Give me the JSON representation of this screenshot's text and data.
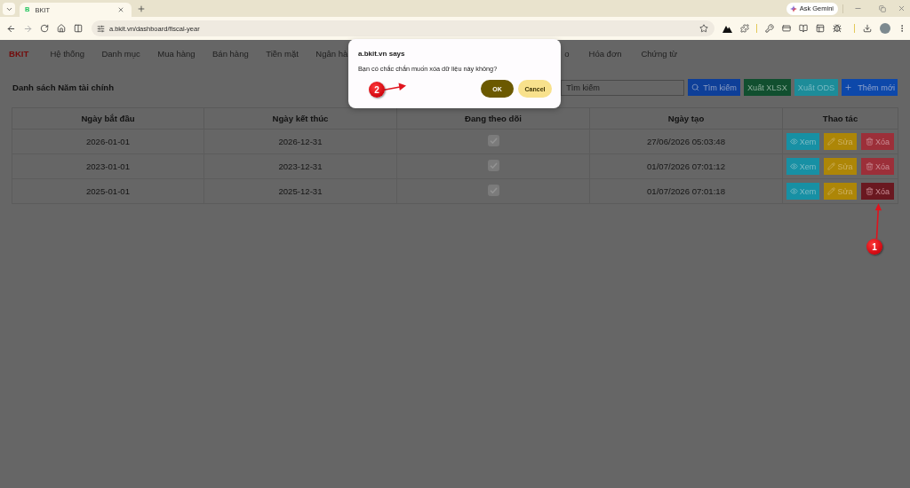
{
  "browser": {
    "tab": {
      "favicon": "B",
      "title": "BKIT"
    },
    "forward_disabled": true,
    "address": "a.bkit.vn/dashboard/fiscal-year",
    "gemini": "Ask Gemini"
  },
  "menu": {
    "brand": "BKIT",
    "items_left": [
      "Hệ thống",
      "Danh mục",
      "Mua hàng",
      "Bán hàng",
      "Tiền mặt",
      "Ngân hà"
    ],
    "items_right": [
      "o",
      "Hóa đơn",
      "Chứng từ"
    ]
  },
  "toolbar": {
    "title": "Danh sách Năm tài chính",
    "search": {
      "placeholder": "Tìm kiếm"
    },
    "buttons": [
      {
        "kind": "search",
        "label": "Tìm kiếm"
      },
      {
        "kind": "xlsx",
        "label": "Xuất XLSX"
      },
      {
        "kind": "ods",
        "label": "Xuất ODS"
      },
      {
        "kind": "add",
        "label": "Thêm mới"
      }
    ]
  },
  "table": {
    "columns": [
      "Ngày bắt đầu",
      "Ngày kết thúc",
      "Đang theo dõi",
      "Ngày tạo",
      "Thao tác"
    ],
    "rows": [
      {
        "start": "2026-01-01",
        "end": "2026-12-31",
        "tracking": true,
        "created": "27/06/2026 05:03:48",
        "actions": [
          {
            "kind": "view",
            "label": "Xem",
            "hovered": false
          },
          {
            "kind": "edit",
            "label": "Sửa",
            "hovered": false
          },
          {
            "kind": "delete",
            "label": "Xóa",
            "hovered": false
          }
        ]
      },
      {
        "start": "2023-01-01",
        "end": "2023-12-31",
        "tracking": true,
        "created": "01/07/2026 07:01:12",
        "actions": [
          {
            "kind": "view",
            "label": "Xem",
            "hovered": false
          },
          {
            "kind": "edit",
            "label": "Sửa",
            "hovered": false
          },
          {
            "kind": "delete",
            "label": "Xóa",
            "hovered": false
          }
        ]
      },
      {
        "start": "2025-01-01",
        "end": "2025-12-31",
        "tracking": true,
        "created": "01/07/2026 07:01:18",
        "actions": [
          {
            "kind": "view",
            "label": "Xem",
            "hovered": false
          },
          {
            "kind": "edit",
            "label": "Sửa",
            "hovered": false
          },
          {
            "kind": "delete",
            "label": "Xóa",
            "hovered": true
          }
        ]
      }
    ]
  },
  "dialog": {
    "title": "a.bkit.vn says",
    "message": "Bạn có chắc chắn muốn xóa dữ liệu này không?",
    "buttons": [
      {
        "kind": "ok",
        "label": "OK"
      },
      {
        "kind": "cancel",
        "label": "Cancel"
      }
    ]
  },
  "annotations": [
    {
      "label": "1"
    },
    {
      "label": "2"
    }
  ]
}
